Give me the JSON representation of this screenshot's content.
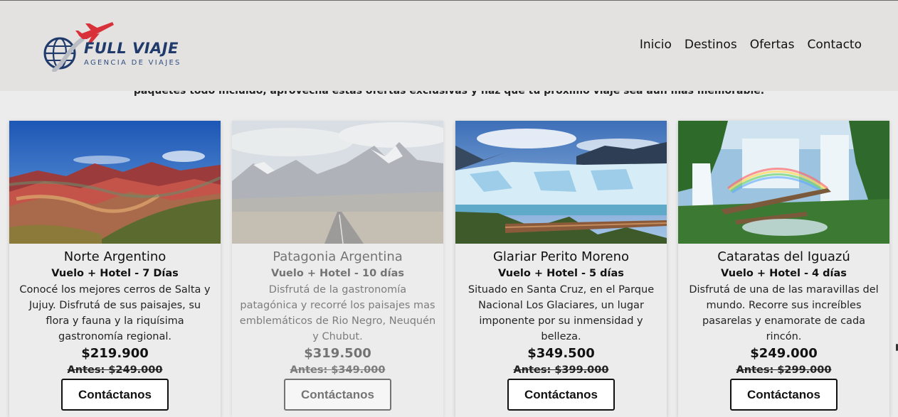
{
  "brand": {
    "name": "FULL VIAJE",
    "tagline": "AGENCIA DE VIAJES"
  },
  "nav": {
    "items": [
      "Inicio",
      "Destinos",
      "Ofertas",
      "Contacto"
    ]
  },
  "intro": {
    "text": "paquetes todo incluido, aprovecha estas ofertas exclusivas y haz que tu próximo viaje sea aún más memorable."
  },
  "cards": [
    {
      "title": "Norte Argentino",
      "subtitle": "Vuelo + Hotel - 7 Días",
      "description": "Conocé los mejores cerros de Salta y Jujuy. Disfrutá de sus paisajes, su flora y fauna y la riquísima gastronomía regional.",
      "price": "$219.900",
      "old_price": "Antes: $249.000",
      "button": "Contáctanos",
      "image": "mountains-of-seven-colors"
    },
    {
      "title": "Patagonia Argentina",
      "subtitle": "Vuelo + Hotel - 10 días",
      "description": "Disfrutá de la gastronomía patagónica y recorré los paisajes mas emblemáticos de Rio Negro, Neuquén y Chubut.",
      "price": "$319.500",
      "old_price": "Antes: $349.000",
      "button": "Contáctanos",
      "image": "fitz-roy-road"
    },
    {
      "title": "Glariar Perito Moreno",
      "subtitle": "Vuelo + Hotel - 5 días",
      "description": "Situado en Santa Cruz, en el Parque Nacional Los Glaciares, un lugar imponente por su inmensidad y belleza.",
      "price": "$349.500",
      "old_price": "Antes: $399.000",
      "button": "Contáctanos",
      "image": "glacier"
    },
    {
      "title": "Cataratas del Iguazú",
      "subtitle": "Vuelo + Hotel - 4 días",
      "description": "Disfrutá de una de las maravillas del mundo. Recorre sus increíbles pasarelas y enamorate de cada rincón.",
      "price": "$249.000",
      "old_price": "Antes: $299.000",
      "button": "Contáctanos",
      "image": "waterfalls"
    }
  ]
}
